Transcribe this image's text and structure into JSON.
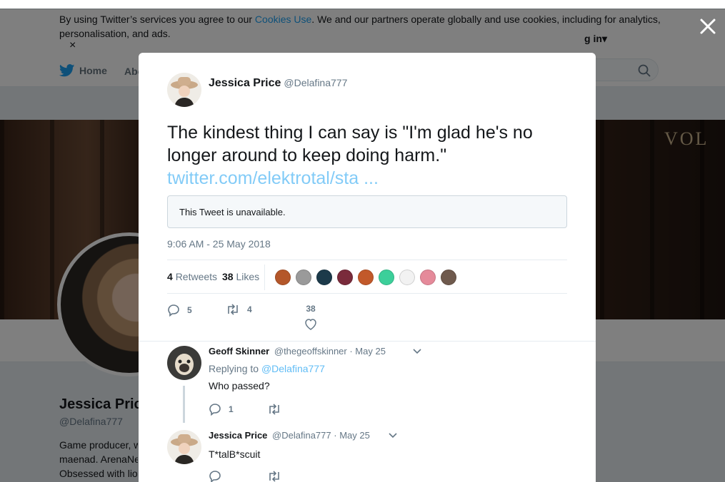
{
  "cookie_banner": {
    "text_before": "By using Twitter’s services you agree to our ",
    "link": "Cookies Use",
    "text_after": ". We and our partners operate globally and use cookies, including for analytics, personalisation, and ads.",
    "close": "×"
  },
  "nav": {
    "home": "Home",
    "about": "Abo",
    "login": "g in▾"
  },
  "banner_text": "VOL",
  "profile": {
    "name": "Jessica Pric",
    "handle": "@Delafina777",
    "bio_lines": [
      "Game producer, w",
      "maenad. ArenaNe",
      "Obsessed with lio"
    ]
  },
  "tweet": {
    "author_name": "Jessica Price",
    "author_handle": "@Delafina777",
    "text": "The kindest thing I can say is \"I'm glad he's no longer around to keep doing harm.\"",
    "link": "twitter.com/elektrotal/sta ...",
    "unavailable": "This Tweet is unavailable.",
    "timestamp": "9:06 AM - 25 May 2018",
    "retweets_count": "4",
    "retweets_label": "Retweets",
    "likes_count": "38",
    "likes_label": "Likes",
    "reply_count": "5",
    "retweet_count_action": "4",
    "like_count_action": "38"
  },
  "liker_colors": [
    "#b4572a",
    "#9a9a9a",
    "#1c3a4a",
    "#7a2b3b",
    "#c2592a",
    "#3ccf9a",
    "#f2f2f2",
    "#e58a9a",
    "#6f5a4d"
  ],
  "replies": [
    {
      "name": "Geoff Skinner",
      "handle": "@thegeoffskinner",
      "date": "· May 25",
      "replying_prefix": "Replying to",
      "replying_to": "@Delafina777",
      "text": "Who passed?",
      "reply_count": "1",
      "retweet_count": ""
    },
    {
      "name": "Jessica Price",
      "handle": "@Delafina777",
      "date": "· May 25",
      "text": "T*talB*scuit",
      "reply_count": "",
      "retweet_count": ""
    }
  ],
  "colors": {
    "brand": "#1da1f2",
    "text": "#14171a",
    "muted": "#657786"
  }
}
